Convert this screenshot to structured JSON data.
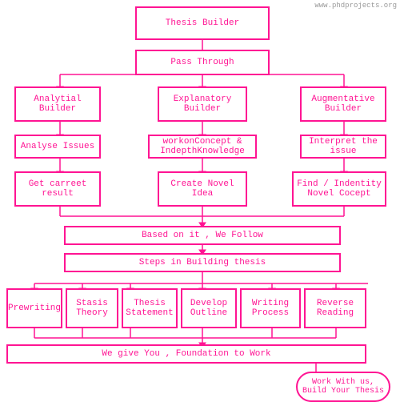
{
  "watermark": "www.phdprojects.org",
  "boxes": {
    "thesis_builder": {
      "label": "Thesis Builder"
    },
    "pass_through": {
      "label": "Pass Through"
    },
    "analytical": {
      "label": "Analytial\nBuilder"
    },
    "explanatory": {
      "label": "Explanatory\nBuilder"
    },
    "augmentative": {
      "label": "Augmentative\nBuilder"
    },
    "analyse_issues": {
      "label": "Analyse Issues"
    },
    "workon": {
      "label": "workonConcept &\nIndepthKnowledge"
    },
    "interpret": {
      "label": "Interpret the\nissue"
    },
    "get_carret": {
      "label": "Get carreet\nresult"
    },
    "create_novel": {
      "label": "Create Novel\nIdea"
    },
    "find_indentity": {
      "label": "Find / Indentity\nNovel Cocept"
    },
    "based_on": {
      "label": "Based on it , We Follow"
    },
    "steps": {
      "label": "Steps in Building thesis"
    },
    "prewriting": {
      "label": "Prewriting"
    },
    "stasis": {
      "label": "Stasis\nTheory"
    },
    "thesis_statement": {
      "label": "Thesis\nStatement"
    },
    "develop_outline": {
      "label": "Develop\nOutline"
    },
    "writing_process": {
      "label": "Writing\nProcess"
    },
    "reverse_reading": {
      "label": "Reverse\nReading"
    },
    "foundation": {
      "label": "We give You , Foundation to Work"
    },
    "work_with": {
      "label": "Work With us,\nBuild Your Thesis"
    }
  }
}
